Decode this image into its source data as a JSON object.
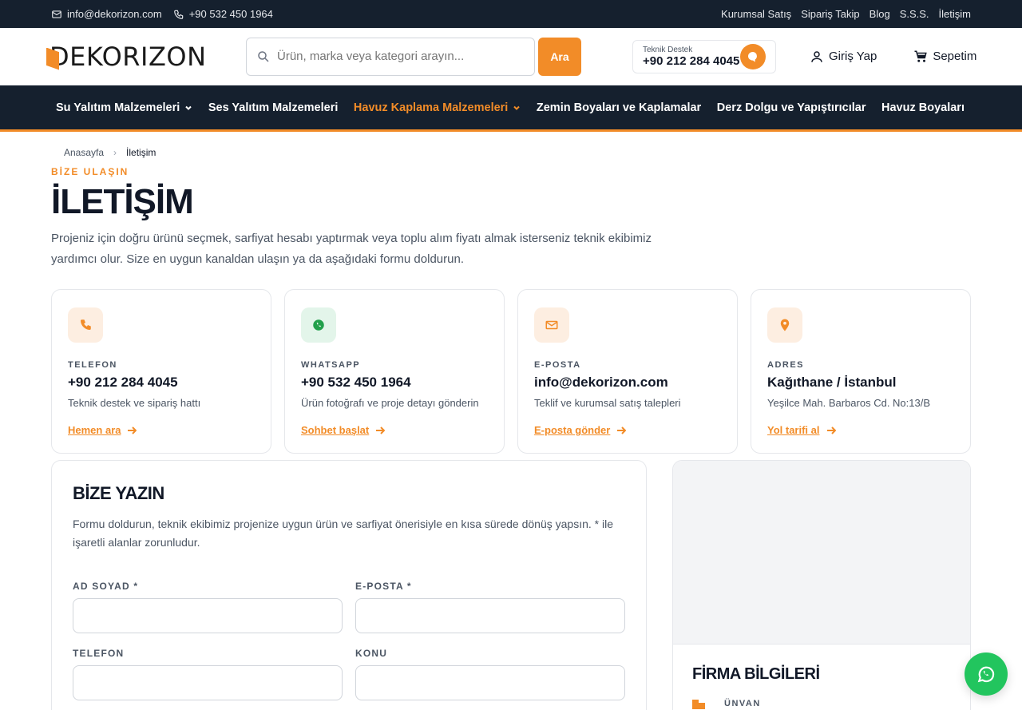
{
  "topbar": {
    "email": "info@dekorizon.com",
    "phone": "+90 532 450 1964",
    "links": [
      "Kurumsal Satış",
      "Sipariş Takip",
      "Blog",
      "S.S.S.",
      "İletişim"
    ]
  },
  "header": {
    "logo_text": "DEKORIZON",
    "search_placeholder": "Ürün, marka veya kategori arayın...",
    "search_button": "Ara",
    "support_label": "Teknik Destek",
    "support_number": "+90 212 284 4045",
    "login": "Giriş Yap",
    "cart": "Sepetim"
  },
  "nav": [
    {
      "label": "Su Yalıtım Malzemeleri",
      "dropdown": true,
      "active": false
    },
    {
      "label": "Ses Yalıtım Malzemeleri",
      "dropdown": false,
      "active": false
    },
    {
      "label": "Havuz Kaplama Malzemeleri",
      "dropdown": true,
      "active": true
    },
    {
      "label": "Zemin Boyaları ve Kaplamalar",
      "dropdown": false,
      "active": false
    },
    {
      "label": "Derz Dolgu ve Yapıştırıcılar",
      "dropdown": false,
      "active": false
    },
    {
      "label": "Havuz Boyaları",
      "dropdown": false,
      "active": false
    }
  ],
  "breadcrumb": {
    "home": "Anasayfa",
    "current": "İletişim"
  },
  "intro": {
    "eyebrow": "BİZE ULAŞIN",
    "title": "İLETİŞİM",
    "text": "Projeniz için doğru ürünü seçmek, sarfiyat hesabı yaptırmak veya toplu alım fiyatı almak isterseniz teknik ekibimiz yardımcı olur. Size en uygun kanaldan ulaşın ya da aşağıdaki formu doldurun."
  },
  "cards": [
    {
      "label": "TELEFON",
      "value": "+90 212 284 4045",
      "desc": "Teknik destek ve sipariş hattı",
      "action": "Hemen ara",
      "icon": "phone-icon"
    },
    {
      "label": "WHATSAPP",
      "value": "+90 532 450 1964",
      "desc": "Ürün fotoğrafı ve proje detayı gönderin",
      "action": "Sohbet başlat",
      "icon": "whatsapp-icon"
    },
    {
      "label": "E-POSTA",
      "value": "info@dekorizon.com",
      "desc": "Teklif ve kurumsal satış talepleri",
      "action": "E-posta gönder",
      "icon": "mail-icon"
    },
    {
      "label": "ADRES",
      "value": "Kağıthane / İstanbul",
      "desc": "Yeşilce Mah. Barbaros Cd. No:13/B",
      "action": "Yol tarifi al",
      "icon": "location-pin-icon"
    }
  ],
  "form": {
    "title": "BİZE YAZIN",
    "desc": "Formu doldurun, teknik ekibimiz projenize uygun ürün ve sarfiyat önerisiyle en kısa sürede dönüş yapsın. * ile işaretli alanlar zorunludur.",
    "fields": {
      "name": "AD SOYAD *",
      "email": "E-POSTA *",
      "phone": "TELEFON",
      "subject": "KONU"
    }
  },
  "info": {
    "title": "FİRMA BİLGİLERİ",
    "unvan_label": "ÜNVAN"
  },
  "colors": {
    "accent": "#f28c28",
    "dark": "#15202e",
    "whatsapp": "#22c55e"
  }
}
